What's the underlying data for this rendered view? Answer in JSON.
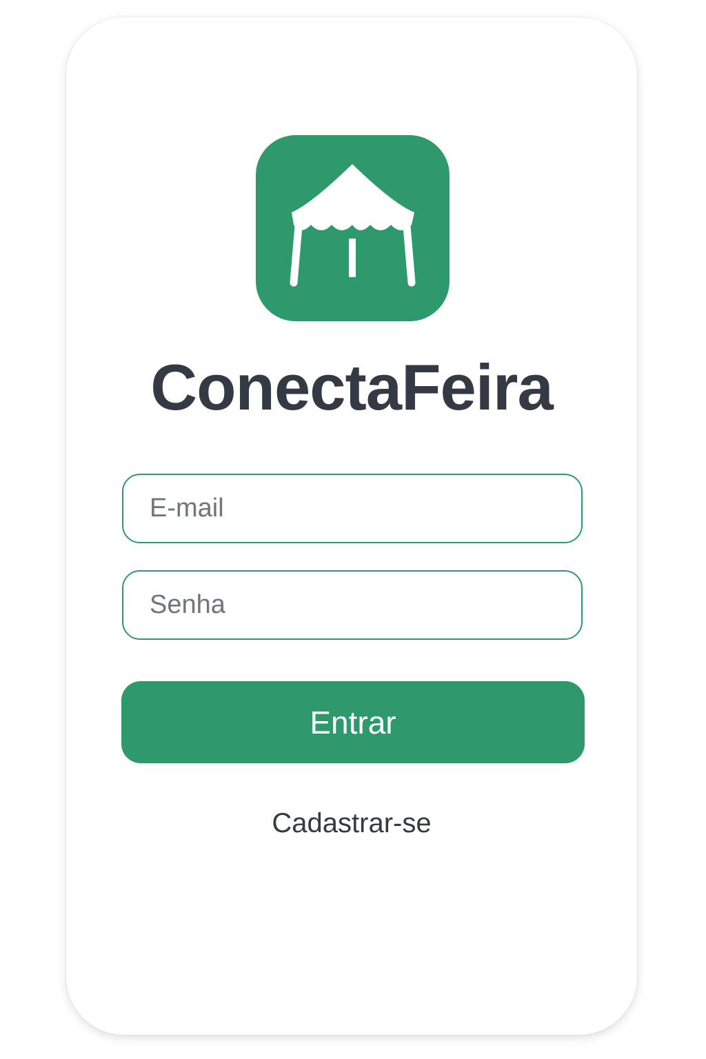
{
  "app": {
    "title": "ConectaFeira",
    "icon": "market-tent-icon",
    "accent_color": "#2e9a6c",
    "text_color": "#343a43"
  },
  "login_form": {
    "email_placeholder": "E-mail",
    "email_value": "",
    "password_placeholder": "Senha",
    "password_value": "",
    "submit_label": "Entrar",
    "signup_label": "Cadastrar-se"
  }
}
